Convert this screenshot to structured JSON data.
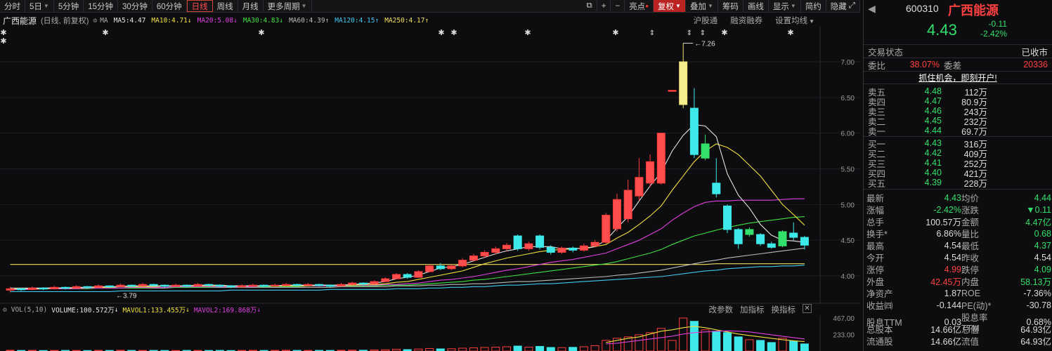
{
  "toolbar": {
    "periods": [
      "分时",
      "5日",
      "5分钟",
      "15分钟",
      "30分钟",
      "60分钟",
      "日线",
      "周线",
      "月线",
      "更多周期"
    ],
    "active_period": "日线",
    "right_buttons": [
      "亮点",
      "复权",
      "叠加",
      "筹码",
      "画线",
      "显示",
      "简约",
      "隐藏"
    ]
  },
  "ma_row": {
    "stock_name": "广西能源",
    "sub": "(日线, 前复权)",
    "ma_label": "MA",
    "items": [
      {
        "text": "MA5:4.47",
        "color": "#e6e6e6"
      },
      {
        "text": "MA10:4.71",
        "color": "#f0e040"
      },
      {
        "text": "MA20:5.08",
        "color": "#e040e0"
      },
      {
        "text": "MA30:4.83",
        "color": "#40e040"
      },
      {
        "text": "MA60:4.39",
        "color": "#bbbbbb"
      },
      {
        "text": "MA120:4.15",
        "color": "#40c8f0"
      },
      {
        "text": "MA250:4.17",
        "color": "#f0e060"
      }
    ],
    "right": [
      "沪股通",
      "融资融券",
      "设置均线"
    ]
  },
  "chart_data": {
    "type": "candlestick",
    "yticks": [
      "7.00",
      "6.50",
      "6.00",
      "5.50",
      "5.00",
      "4.50",
      "4.00"
    ],
    "high_label": "7.26",
    "low_label": "3.79",
    "candles": [
      [
        3.8,
        3.82,
        3.77,
        3.84
      ],
      [
        3.82,
        3.81,
        3.79,
        3.83
      ],
      [
        3.81,
        3.83,
        3.8,
        3.85
      ],
      [
        3.83,
        3.82,
        3.8,
        3.84
      ],
      [
        3.82,
        3.84,
        3.81,
        3.86
      ],
      [
        3.84,
        3.83,
        3.81,
        3.85
      ],
      [
        3.83,
        3.85,
        3.82,
        3.87
      ],
      [
        3.85,
        3.84,
        3.82,
        3.86
      ],
      [
        3.84,
        3.86,
        3.83,
        3.88
      ],
      [
        3.86,
        3.85,
        3.83,
        3.87
      ],
      [
        3.85,
        3.87,
        3.84,
        3.89
      ],
      [
        3.87,
        3.86,
        3.84,
        3.88
      ],
      [
        3.86,
        3.88,
        3.85,
        3.9
      ],
      [
        3.88,
        3.87,
        3.85,
        3.89
      ],
      [
        3.87,
        3.86,
        3.84,
        3.88
      ],
      [
        3.86,
        3.87,
        3.85,
        3.89
      ],
      [
        3.87,
        3.86,
        3.84,
        3.88
      ],
      [
        3.86,
        3.88,
        3.85,
        3.9
      ],
      [
        3.88,
        3.87,
        3.85,
        3.89
      ],
      [
        3.87,
        3.86,
        3.84,
        3.88
      ],
      [
        3.86,
        3.85,
        3.83,
        3.87
      ],
      [
        3.85,
        3.86,
        3.84,
        3.88
      ],
      [
        3.86,
        3.87,
        3.85,
        3.89
      ],
      [
        3.87,
        3.86,
        3.84,
        3.88
      ],
      [
        3.86,
        3.87,
        3.85,
        3.89
      ],
      [
        3.87,
        3.88,
        3.86,
        3.9
      ],
      [
        3.88,
        3.87,
        3.85,
        3.89
      ],
      [
        3.87,
        3.88,
        3.86,
        3.9
      ],
      [
        3.88,
        3.87,
        3.85,
        3.89
      ],
      [
        3.87,
        3.86,
        3.84,
        3.88
      ],
      [
        3.86,
        3.88,
        3.85,
        3.9
      ],
      [
        3.88,
        3.9,
        3.87,
        3.92
      ],
      [
        3.9,
        3.89,
        3.86,
        3.91
      ],
      [
        3.89,
        3.92,
        3.88,
        3.94
      ],
      [
        3.92,
        3.96,
        3.91,
        3.98
      ],
      [
        3.96,
        4.02,
        3.95,
        4.04
      ],
      [
        4.02,
        3.98,
        3.96,
        4.04
      ],
      [
        3.98,
        4.06,
        3.97,
        4.08
      ],
      [
        4.06,
        4.14,
        4.05,
        4.16
      ],
      [
        4.14,
        4.1,
        4.08,
        4.18
      ],
      [
        4.1,
        4.14,
        4.08,
        4.16
      ],
      [
        4.14,
        4.22,
        4.12,
        4.25
      ],
      [
        4.22,
        4.28,
        4.2,
        4.31
      ],
      [
        4.28,
        4.33,
        4.25,
        4.36
      ],
      [
        4.33,
        4.38,
        4.3,
        4.41
      ],
      [
        4.38,
        4.43,
        4.35,
        4.46
      ],
      [
        4.56,
        4.38,
        4.35,
        4.58
      ],
      [
        4.38,
        4.45,
        4.35,
        4.48
      ],
      [
        4.56,
        4.4,
        4.37,
        4.58
      ],
      [
        4.4,
        4.33,
        4.3,
        4.43
      ],
      [
        4.33,
        4.39,
        4.31,
        4.41
      ],
      [
        4.39,
        4.36,
        4.33,
        4.41
      ],
      [
        4.36,
        4.42,
        4.34,
        4.45
      ],
      [
        4.42,
        4.47,
        4.4,
        4.5
      ],
      [
        4.47,
        4.85,
        4.45,
        4.88
      ],
      [
        4.66,
        5.07,
        4.62,
        5.15
      ],
      [
        4.8,
        5.2,
        4.75,
        5.35
      ],
      [
        5.12,
        5.38,
        5.05,
        5.65
      ],
      [
        5.3,
        5.6,
        5.25,
        5.7
      ],
      [
        5.3,
        6.0,
        5.28,
        6.0
      ],
      [
        6.6,
        6.6,
        6.6,
        6.6
      ],
      [
        6.4,
        7.0,
        6.35,
        7.26
      ],
      [
        6.35,
        5.7,
        5.65,
        6.63
      ],
      [
        5.65,
        5.85,
        5.62,
        5.98
      ],
      [
        5.3,
        5.15,
        5.1,
        5.65
      ],
      [
        4.98,
        4.65,
        4.6,
        5.0
      ],
      [
        4.65,
        4.45,
        4.38,
        4.67
      ],
      [
        4.58,
        4.65,
        4.55,
        4.68
      ],
      [
        4.58,
        4.45,
        4.42,
        4.6
      ],
      [
        4.45,
        4.4,
        4.38,
        4.48
      ],
      [
        4.42,
        4.62,
        4.4,
        4.64
      ],
      [
        4.6,
        4.54,
        4.5,
        4.75
      ],
      [
        4.54,
        4.43,
        4.37,
        4.56
      ]
    ],
    "ma5": [
      3.81,
      3.82,
      3.82,
      3.83,
      3.83,
      3.83,
      3.84,
      3.84,
      3.85,
      3.85,
      3.85,
      3.86,
      3.86,
      3.86,
      3.86,
      3.86,
      3.86,
      3.87,
      3.87,
      3.87,
      3.86,
      3.86,
      3.86,
      3.86,
      3.86,
      3.87,
      3.87,
      3.87,
      3.87,
      3.87,
      3.87,
      3.88,
      3.89,
      3.9,
      3.92,
      3.96,
      3.98,
      4.01,
      4.06,
      4.11,
      4.13,
      4.16,
      4.21,
      4.26,
      4.31,
      4.35,
      4.38,
      4.41,
      4.41,
      4.41,
      4.38,
      4.39,
      4.38,
      4.41,
      4.5,
      4.67,
      4.83,
      5.05,
      5.26,
      5.45,
      5.75,
      5.97,
      6.12,
      6.1,
      5.95,
      5.43,
      5.13,
      4.95,
      4.72,
      4.57,
      4.5,
      4.49,
      4.47
    ],
    "ma10": [
      3.82,
      3.82,
      3.82,
      3.82,
      3.83,
      3.83,
      3.83,
      3.84,
      3.84,
      3.84,
      3.85,
      3.85,
      3.85,
      3.85,
      3.86,
      3.86,
      3.86,
      3.86,
      3.86,
      3.86,
      3.86,
      3.86,
      3.86,
      3.86,
      3.86,
      3.86,
      3.86,
      3.86,
      3.87,
      3.87,
      3.87,
      3.87,
      3.88,
      3.88,
      3.89,
      3.91,
      3.92,
      3.95,
      3.98,
      4.01,
      4.04,
      4.07,
      4.12,
      4.17,
      4.21,
      4.25,
      4.28,
      4.31,
      4.34,
      4.36,
      4.37,
      4.38,
      4.39,
      4.41,
      4.44,
      4.53,
      4.61,
      4.72,
      4.84,
      4.98,
      5.2,
      5.4,
      5.6,
      5.75,
      5.85,
      5.8,
      5.7,
      5.55,
      5.4,
      5.2,
      5.0,
      4.86,
      4.71
    ],
    "ma20": [
      3.81,
      3.81,
      3.81,
      3.82,
      3.82,
      3.82,
      3.82,
      3.83,
      3.83,
      3.83,
      3.83,
      3.84,
      3.84,
      3.84,
      3.84,
      3.85,
      3.85,
      3.85,
      3.85,
      3.85,
      3.85,
      3.85,
      3.85,
      3.86,
      3.86,
      3.86,
      3.86,
      3.86,
      3.86,
      3.86,
      3.86,
      3.87,
      3.87,
      3.87,
      3.88,
      3.88,
      3.89,
      3.9,
      3.92,
      3.94,
      3.95,
      3.97,
      3.99,
      4.02,
      4.05,
      4.08,
      4.1,
      4.13,
      4.16,
      4.19,
      4.21,
      4.23,
      4.26,
      4.29,
      4.32,
      4.38,
      4.44,
      4.5,
      4.58,
      4.66,
      4.78,
      4.88,
      4.97,
      5.03,
      5.05,
      5.05,
      5.06,
      5.06,
      5.06,
      5.06,
      5.07,
      5.08,
      5.08
    ],
    "ma30": [
      3.82,
      3.82,
      3.82,
      3.82,
      3.82,
      3.82,
      3.82,
      3.82,
      3.83,
      3.83,
      3.83,
      3.83,
      3.83,
      3.84,
      3.84,
      3.84,
      3.84,
      3.84,
      3.84,
      3.85,
      3.85,
      3.85,
      3.85,
      3.85,
      3.85,
      3.85,
      3.85,
      3.86,
      3.86,
      3.86,
      3.86,
      3.86,
      3.86,
      3.86,
      3.87,
      3.87,
      3.87,
      3.88,
      3.89,
      3.9,
      3.91,
      3.92,
      3.94,
      3.95,
      3.97,
      3.99,
      4.01,
      4.03,
      4.05,
      4.07,
      4.09,
      4.11,
      4.13,
      4.15,
      4.17,
      4.2,
      4.24,
      4.28,
      4.32,
      4.37,
      4.44,
      4.5,
      4.56,
      4.6,
      4.64,
      4.68,
      4.71,
      4.74,
      4.76,
      4.78,
      4.8,
      4.82,
      4.83
    ],
    "ma60": [
      3.83,
      3.83,
      3.83,
      3.83,
      3.83,
      3.83,
      3.83,
      3.83,
      3.83,
      3.83,
      3.83,
      3.83,
      3.83,
      3.83,
      3.83,
      3.84,
      3.84,
      3.84,
      3.84,
      3.84,
      3.84,
      3.84,
      3.84,
      3.84,
      3.84,
      3.84,
      3.84,
      3.84,
      3.84,
      3.84,
      3.85,
      3.85,
      3.85,
      3.85,
      3.85,
      3.86,
      3.86,
      3.86,
      3.87,
      3.87,
      3.88,
      3.88,
      3.89,
      3.89,
      3.9,
      3.91,
      3.92,
      3.92,
      3.93,
      3.94,
      3.95,
      3.96,
      3.97,
      3.98,
      3.99,
      4.01,
      4.02,
      4.04,
      4.06,
      4.08,
      4.11,
      4.14,
      4.17,
      4.2,
      4.22,
      4.25,
      4.27,
      4.29,
      4.31,
      4.33,
      4.35,
      4.37,
      4.39
    ],
    "ma120": [
      3.78,
      3.78,
      3.78,
      3.78,
      3.78,
      3.78,
      3.78,
      3.78,
      3.78,
      3.78,
      3.79,
      3.79,
      3.79,
      3.79,
      3.79,
      3.79,
      3.79,
      3.79,
      3.79,
      3.79,
      3.8,
      3.8,
      3.8,
      3.8,
      3.8,
      3.8,
      3.8,
      3.8,
      3.8,
      3.81,
      3.81,
      3.81,
      3.81,
      3.81,
      3.81,
      3.82,
      3.82,
      3.82,
      3.83,
      3.83,
      3.84,
      3.84,
      3.85,
      3.85,
      3.86,
      3.87,
      3.87,
      3.88,
      3.89,
      3.89,
      3.9,
      3.91,
      3.92,
      3.93,
      3.94,
      3.95,
      3.96,
      3.97,
      3.98,
      3.99,
      4.01,
      4.03,
      4.05,
      4.07,
      4.08,
      4.1,
      4.11,
      4.12,
      4.13,
      4.13,
      4.14,
      4.14,
      4.15
    ],
    "ma250": [
      4.16,
      4.16,
      4.16,
      4.16,
      4.16,
      4.16,
      4.16,
      4.16,
      4.16,
      4.16,
      4.16,
      4.16,
      4.16,
      4.16,
      4.16,
      4.16,
      4.16,
      4.16,
      4.16,
      4.16,
      4.16,
      4.16,
      4.16,
      4.16,
      4.16,
      4.16,
      4.16,
      4.16,
      4.16,
      4.16,
      4.16,
      4.16,
      4.16,
      4.16,
      4.16,
      4.16,
      4.16,
      4.16,
      4.16,
      4.16,
      4.16,
      4.16,
      4.16,
      4.16,
      4.16,
      4.16,
      4.16,
      4.16,
      4.16,
      4.16,
      4.16,
      4.16,
      4.16,
      4.16,
      4.16,
      4.16,
      4.16,
      4.16,
      4.16,
      4.16,
      4.16,
      4.16,
      4.16,
      4.16,
      4.17,
      4.17,
      4.17,
      4.17,
      4.17,
      4.17,
      4.17,
      4.17,
      4.17
    ],
    "vol_yticks": [
      "467.00",
      "233.00"
    ],
    "volumes": [
      10,
      8,
      9,
      7,
      8,
      9,
      8,
      7,
      9,
      8,
      10,
      9,
      8,
      9,
      8,
      7,
      9,
      8,
      8,
      9,
      7,
      8,
      9,
      8,
      9,
      10,
      9,
      8,
      9,
      8,
      10,
      12,
      11,
      14,
      18,
      25,
      20,
      28,
      35,
      30,
      32,
      40,
      45,
      50,
      55,
      60,
      70,
      55,
      65,
      50,
      48,
      52,
      60,
      75,
      150,
      180,
      200,
      230,
      260,
      320,
      150,
      467,
      420,
      300,
      280,
      260,
      200,
      160,
      150,
      120,
      180,
      140,
      100.57
    ],
    "mavol1": [
      0,
      0,
      0,
      0,
      0,
      0,
      0,
      0,
      0,
      0,
      0,
      0,
      0,
      0,
      0,
      0,
      0,
      0,
      0,
      0,
      0,
      0,
      0,
      0,
      0,
      0,
      0,
      0,
      0,
      0,
      0,
      0,
      0,
      0,
      0,
      0,
      0,
      0,
      0,
      0,
      0,
      0,
      0,
      0,
      0,
      0,
      0,
      0,
      0,
      0,
      0,
      0,
      0,
      0,
      120,
      150,
      180,
      200,
      240,
      280,
      300,
      330,
      350,
      330,
      300,
      270,
      240,
      220,
      200,
      180,
      160,
      145,
      133.455
    ],
    "mavol2": [
      0,
      0,
      0,
      0,
      0,
      0,
      0,
      0,
      0,
      0,
      0,
      0,
      0,
      0,
      0,
      0,
      0,
      0,
      0,
      0,
      0,
      0,
      0,
      0,
      0,
      0,
      0,
      0,
      0,
      0,
      0,
      0,
      0,
      0,
      0,
      0,
      0,
      0,
      0,
      0,
      0,
      0,
      0,
      0,
      0,
      0,
      0,
      0,
      0,
      0,
      0,
      0,
      0,
      0,
      100,
      110,
      130,
      150,
      170,
      190,
      210,
      240,
      260,
      270,
      280,
      285,
      280,
      270,
      250,
      230,
      210,
      190,
      169.868
    ]
  },
  "vol_row": {
    "label": "VOL(5,10)",
    "volume": "VOLUME:100.572万",
    "mavol1": "MAVOL1:133.455万",
    "mavol2": "MAVOL2:169.868万",
    "right": [
      "改参数",
      "加指标",
      "换指标"
    ]
  },
  "panel": {
    "code": "600310",
    "name": "广西能源",
    "price": "4.43",
    "change": "-0.11",
    "change_pct": "-2.42%",
    "trade_state_label": "交易状态",
    "trade_state": "已收市",
    "weibi_label": "委比",
    "weibi": "38.07%",
    "weicha_label": "委差",
    "weicha": "20336",
    "promo": "抓住机会，即刻开户!",
    "asks": [
      {
        "label": "卖五",
        "price": "4.48",
        "vol": "112万"
      },
      {
        "label": "卖四",
        "price": "4.47",
        "vol": "80.9万"
      },
      {
        "label": "卖三",
        "price": "4.46",
        "vol": "243万"
      },
      {
        "label": "卖二",
        "price": "4.45",
        "vol": "232万"
      },
      {
        "label": "卖一",
        "price": "4.44",
        "vol": "69.7万"
      }
    ],
    "bids": [
      {
        "label": "买一",
        "price": "4.43",
        "vol": "316万"
      },
      {
        "label": "买二",
        "price": "4.42",
        "vol": "409万"
      },
      {
        "label": "买三",
        "price": "4.41",
        "vol": "252万"
      },
      {
        "label": "买四",
        "price": "4.40",
        "vol": "421万"
      },
      {
        "label": "买五",
        "price": "4.39",
        "vol": "228万"
      }
    ],
    "stats": [
      [
        {
          "l": "最新",
          "v": "4.43",
          "c": "green"
        },
        {
          "l": "均价",
          "v": "4.44",
          "c": "green"
        }
      ],
      [
        {
          "l": "涨幅",
          "v": "-2.42%",
          "c": "green"
        },
        {
          "l": "涨跌",
          "v": "▼0.11",
          "c": "green"
        }
      ],
      [
        {
          "l": "总手",
          "v": "100.57万",
          "c": "white"
        },
        {
          "l": "金额",
          "v": "4.47亿",
          "c": "green"
        }
      ],
      [
        {
          "l": "换手*",
          "v": "6.86%",
          "c": "white"
        },
        {
          "l": "量比",
          "v": "0.68",
          "c": "green"
        }
      ],
      [
        {
          "l": "最高",
          "v": "4.54",
          "c": "white"
        },
        {
          "l": "最低",
          "v": "4.37",
          "c": "green"
        }
      ],
      [
        {
          "l": "今开",
          "v": "4.54",
          "c": "white"
        },
        {
          "l": "昨收",
          "v": "4.54",
          "c": "white"
        }
      ],
      [
        {
          "l": "涨停",
          "v": "4.99",
          "c": "red"
        },
        {
          "l": "跌停",
          "v": "4.09",
          "c": "green"
        }
      ],
      [
        {
          "l": "外盘",
          "v": "42.45万",
          "c": "red"
        },
        {
          "l": "内盘",
          "v": "58.13万",
          "c": "green"
        }
      ],
      [
        {
          "l": "净资产",
          "v": "1.87",
          "c": "white"
        },
        {
          "l": "ROE",
          "v": "-7.36%",
          "c": "white"
        }
      ],
      [
        {
          "l": "收益㈣",
          "v": "-0.144",
          "c": "white"
        },
        {
          "l": "PE(动)*",
          "v": "-30.78",
          "c": "white"
        }
      ],
      [
        {
          "l": "股息TTM",
          "v": "0.03",
          "c": "white"
        },
        {
          "l": "股息率TTM",
          "v": "0.68%",
          "c": "white"
        }
      ],
      [
        {
          "l": "总股本",
          "v": "14.66亿",
          "c": "white"
        },
        {
          "l": "总值",
          "v": "64.93亿",
          "c": "white"
        }
      ],
      [
        {
          "l": "流通股",
          "v": "14.66亿",
          "c": "white"
        },
        {
          "l": "流值",
          "v": "64.93亿",
          "c": "white"
        }
      ]
    ]
  }
}
